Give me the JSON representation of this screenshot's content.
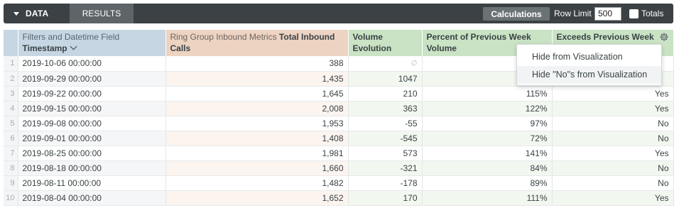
{
  "toolbar": {
    "data_tab": "DATA",
    "results_tab": "RESULTS",
    "calculations_button": "Calculations",
    "row_limit_label": "Row Limit",
    "row_limit_value": "500",
    "totals_label": "Totals",
    "totals_checked": false
  },
  "columns": {
    "dimension": {
      "group": "Filters and Datetime Field",
      "name": "Timestamp"
    },
    "measure": {
      "group": "Ring Group Inbound Metrics",
      "name": "Total Inbound Calls"
    },
    "calc1": "Volume Evolution",
    "calc2": "Percent of Previous Week Volume",
    "calc3": "Exceeds Previous Week"
  },
  "rows": [
    {
      "idx": "1",
      "timestamp": "2019-10-06 00:00:00",
      "calls": "388",
      "evolution": "∅",
      "percent": "",
      "exceeds": ""
    },
    {
      "idx": "2",
      "timestamp": "2019-09-29 00:00:00",
      "calls": "1,435",
      "evolution": "1047",
      "percent": "",
      "exceeds": ""
    },
    {
      "idx": "3",
      "timestamp": "2019-09-22 00:00:00",
      "calls": "1,645",
      "evolution": "210",
      "percent": "115%",
      "exceeds": "Yes"
    },
    {
      "idx": "4",
      "timestamp": "2019-09-15 00:00:00",
      "calls": "2,008",
      "evolution": "363",
      "percent": "122%",
      "exceeds": "Yes"
    },
    {
      "idx": "5",
      "timestamp": "2019-09-08 00:00:00",
      "calls": "1,953",
      "evolution": "-55",
      "percent": "97%",
      "exceeds": "No"
    },
    {
      "idx": "6",
      "timestamp": "2019-09-01 00:00:00",
      "calls": "1,408",
      "evolution": "-545",
      "percent": "72%",
      "exceeds": "No"
    },
    {
      "idx": "7",
      "timestamp": "2019-08-25 00:00:00",
      "calls": "1,981",
      "evolution": "573",
      "percent": "141%",
      "exceeds": "Yes"
    },
    {
      "idx": "8",
      "timestamp": "2019-08-18 00:00:00",
      "calls": "1,660",
      "evolution": "-321",
      "percent": "84%",
      "exceeds": "No"
    },
    {
      "idx": "9",
      "timestamp": "2019-08-11 00:00:00",
      "calls": "1,482",
      "evolution": "-178",
      "percent": "89%",
      "exceeds": "No"
    },
    {
      "idx": "10",
      "timestamp": "2019-08-04 00:00:00",
      "calls": "1,652",
      "evolution": "170",
      "percent": "111%",
      "exceeds": "Yes"
    }
  ],
  "menu": {
    "items": [
      "Hide from Visualization",
      "Hide \"No\"s from Visualization"
    ]
  },
  "colors": {
    "toolbar_bg": "#3b4145",
    "dimension_header": "#c6d6e3",
    "measure_header": "#edd3c2",
    "calculation_header": "#c9e3c4"
  },
  "icons": {
    "data_tab": "caret-down-icon",
    "sort": "chevron-down-icon",
    "column_settings": "gear-icon",
    "null_value": "null-symbol-icon"
  }
}
